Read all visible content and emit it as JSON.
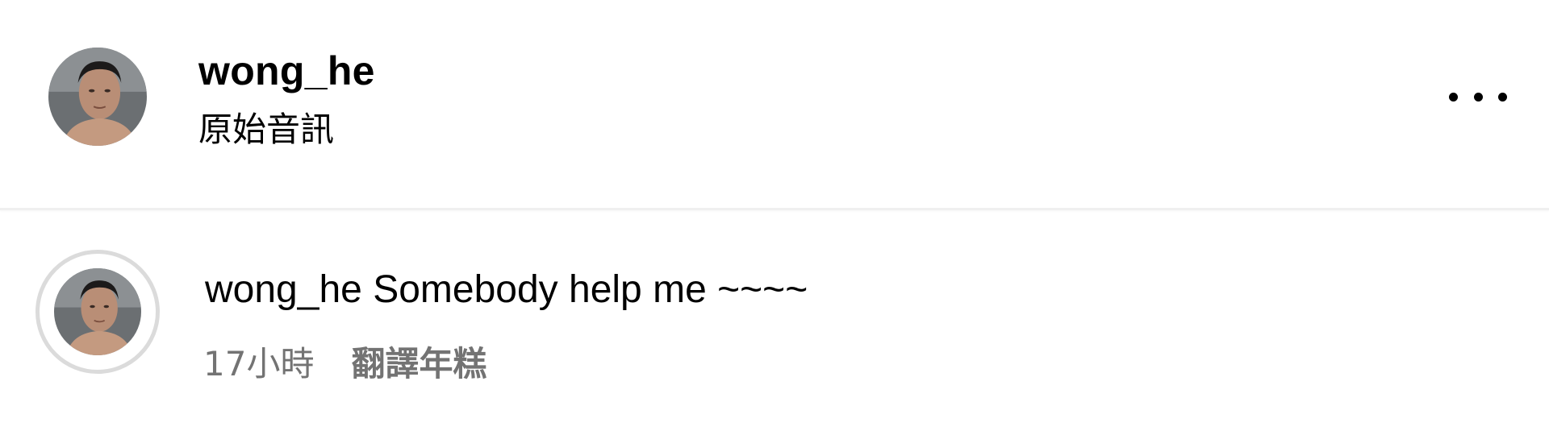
{
  "post_header": {
    "username": "wong_he",
    "audio_label": "原始音訊",
    "more_icon": "more-horizontal-icon"
  },
  "comment": {
    "username": "wong_he",
    "text": "Somebody help me ~~~~",
    "time": "17小時",
    "translate_label": "翻譯年糕"
  },
  "colors": {
    "text_primary": "#000000",
    "text_secondary": "#737373",
    "divider": "#efefef",
    "avatar_ring": "#dbdbdb"
  }
}
